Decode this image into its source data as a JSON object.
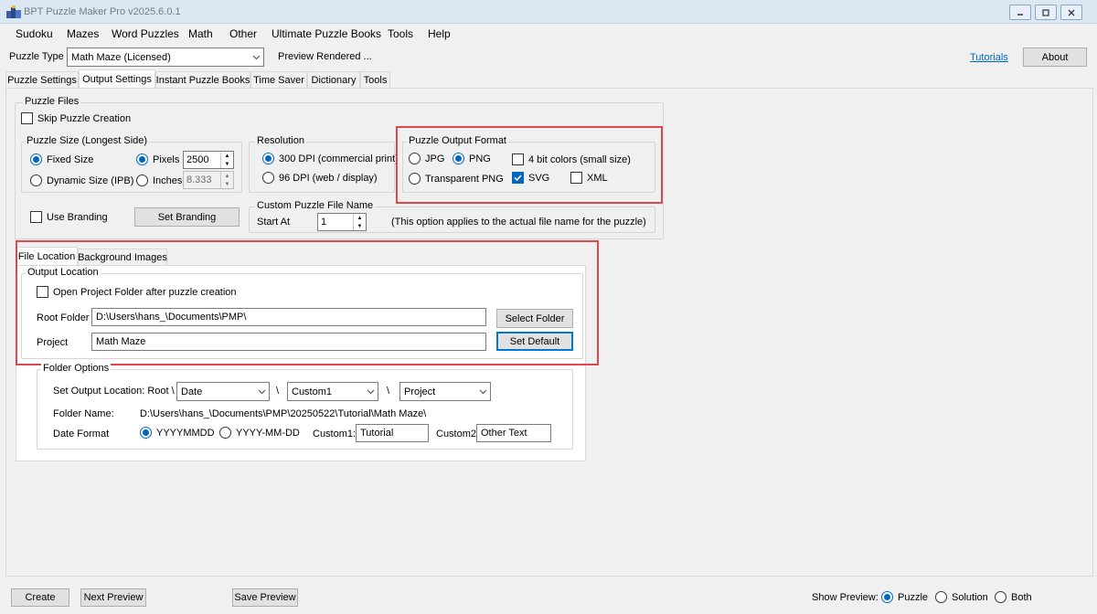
{
  "app": {
    "title": "BPT Puzzle Maker Pro v2025.6.0.1"
  },
  "menu": [
    "Sudoku",
    "Mazes",
    "Word Puzzles",
    "Math",
    "Other",
    "Ultimate Puzzle Books",
    "Tools",
    "Help"
  ],
  "toolbar": {
    "puzzle_type_label": "Puzzle Type",
    "puzzle_type_value": "Math Maze (Licensed)",
    "preview_status": "Preview Rendered ...",
    "tutorials_link": "Tutorials",
    "about_button": "About"
  },
  "main_tabs": [
    "Puzzle Settings",
    "Output Settings",
    "Instant Puzzle Books",
    "Time Saver",
    "Dictionary",
    "Tools"
  ],
  "puzzle_files": {
    "title": "Puzzle Files",
    "skip_creation": "Skip Puzzle Creation",
    "size": {
      "title": "Puzzle Size (Longest Side)",
      "fixed": "Fixed Size",
      "dynamic": "Dynamic Size (IPB)",
      "pixels": "Pixels",
      "pixels_value": "2500",
      "inches": "Inches",
      "inches_value": "8.333"
    },
    "use_branding": "Use Branding",
    "set_branding": "Set Branding"
  },
  "resolution": {
    "title": "Resolution",
    "r300": "300 DPI (commercial print)",
    "r96": "96  DPI (web / display)"
  },
  "output_format": {
    "title": "Puzzle Output Format",
    "jpg": "JPG",
    "png": "PNG",
    "transparent_png": "Transparent PNG",
    "four_bit": "4 bit colors (small size)",
    "svg": "SVG",
    "xml": "XML"
  },
  "custom_filename": {
    "title": "Custom Puzzle File Name",
    "start_at": "Start At",
    "start_value": "1",
    "note": "(This option applies to the actual file name for the puzzle)"
  },
  "sub_tabs": [
    "File Location",
    "Background Images"
  ],
  "output_location": {
    "title": "Output Location",
    "open_folder": "Open Project Folder after puzzle creation",
    "root_label": "Root Folder",
    "root_value": "D:\\Users\\hans_\\Documents\\PMP\\",
    "select_folder": "Select Folder",
    "project_label": "Project",
    "project_value": "Math Maze",
    "set_default": "Set Default"
  },
  "folder_options": {
    "title": "Folder Options",
    "set_output_label": "Set Output Location: Root \\",
    "opt1": "Date",
    "opt2": "Custom1",
    "opt3": "Project",
    "sep": "\\",
    "folder_name_label": "Folder Name:",
    "folder_name_value": "D:\\Users\\hans_\\Documents\\PMP\\20250522\\Tutorial\\Math Maze\\",
    "date_format_label": "Date Format",
    "fmt1": "YYYYMMDD",
    "fmt2": "YYYY-MM-DD",
    "custom1_label": "Custom1:",
    "custom1_value": "Tutorial",
    "custom2_label": "Custom2:",
    "custom2_value": "Other Text"
  },
  "bottom": {
    "create": "Create",
    "next_preview": "Next Preview",
    "save_preview": "Save Preview",
    "show_preview_label": "Show Preview:",
    "puzzle": "Puzzle",
    "solution": "Solution",
    "both": "Both"
  },
  "colors": {
    "accent": "#0067c0",
    "highlight_box": "#e0484d",
    "link": "#0066cc"
  }
}
